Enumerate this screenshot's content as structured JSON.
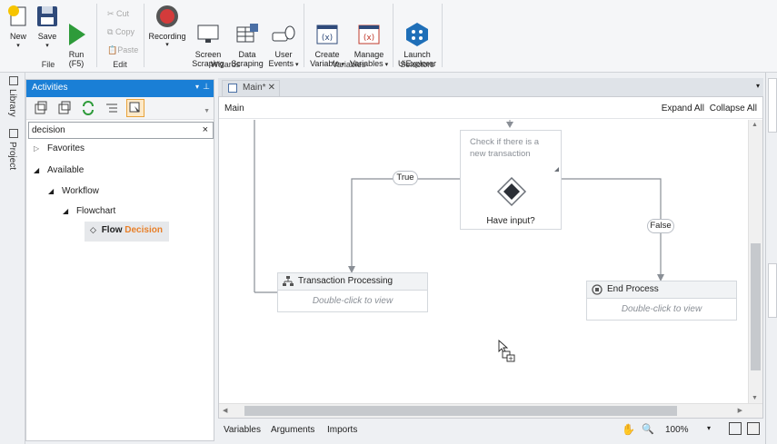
{
  "ribbon": {
    "new_label": "New",
    "save_label": "Save",
    "run_label": "Run\n(F5)",
    "file_group": "File",
    "cut_label": "Cut",
    "copy_label": "Copy",
    "paste_label": "Paste",
    "edit_group": "Edit",
    "recording_label": "Recording",
    "screen_scraping_label": "Screen\nScraping",
    "data_scraping_label": "Data\nScraping",
    "user_events_label": "User\nEvents",
    "wizards_group": "Wizards",
    "create_variable_label": "Create\nVariable",
    "manage_variables_label": "Manage\nVariables",
    "variables_group": "Variables",
    "launch_uiexplorer_label": "Launch\nUiExplorer",
    "selectors_group": "Selectors"
  },
  "left_strip": {
    "library": "Library",
    "project": "Project"
  },
  "activities": {
    "title": "Activities",
    "search_value": "decision",
    "tree": {
      "favorites": "Favorites",
      "available": "Available",
      "workflow": "Workflow",
      "flowchart": "Flowchart",
      "result_prefix": "Flow",
      "result_match": "Decision"
    }
  },
  "designer": {
    "tab_label": "Main*",
    "breadcrumb": "Main",
    "expand_all": "Expand All",
    "collapse_all": "Collapse All",
    "decision": {
      "condition": "Check if there is a new transaction",
      "label": "Have input?"
    },
    "true_label": "True",
    "false_label": "False",
    "transaction": {
      "title": "Transaction Processing",
      "sub": "Double-click to view"
    },
    "end_process": {
      "title": "End Process",
      "sub": "Double-click to view"
    }
  },
  "bottom": {
    "variables": "Variables",
    "arguments": "Arguments",
    "imports": "Imports",
    "zoom": "100%"
  },
  "colors": {
    "accent": "#1a7fd6",
    "run_green": "#2e9b3a",
    "record_red": "#d33b3b",
    "match_orange": "#e8802a"
  }
}
